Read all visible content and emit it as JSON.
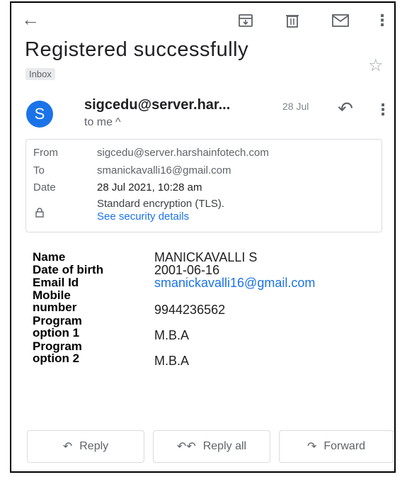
{
  "subject": "Registered successfully",
  "label_badge": "Inbox",
  "sender": {
    "avatar_letter": "S",
    "name": "sigcedu@server.har...",
    "date_short": "28 Jul",
    "to_line": "to me"
  },
  "details": {
    "from_label": "From",
    "from_value": "sigcedu@server.harshainfotech.com",
    "to_label": "To",
    "to_value": "smanickavalli16@gmail.com",
    "date_label": "Date",
    "date_value": "28 Jul 2021, 10:28 am",
    "encryption_text": "Standard encryption (TLS).",
    "security_link": "See security details"
  },
  "body_fields": [
    {
      "label": "Name",
      "value": "MANICKAVALLI S"
    },
    {
      "label": "Date of birth",
      "value": "2001-06-16"
    },
    {
      "label": "Email Id",
      "value": "smanickavalli16@gmail.com"
    },
    {
      "label": "Mobile number",
      "value": "9944236562"
    },
    {
      "label": "Program option 1",
      "value": "M.B.A"
    },
    {
      "label": "Program option 2",
      "value": "M.B.A"
    }
  ],
  "actions": {
    "reply": "Reply",
    "reply_all": "Reply all",
    "forward": "Forward"
  },
  "icons": {
    "back": "arrow-back-icon",
    "archive": "archive-icon",
    "delete": "trash-icon",
    "mark_unread": "mail-icon",
    "more": "more-vert-icon",
    "star": "star-outline-icon",
    "reply": "reply-icon",
    "lock": "lock-icon"
  },
  "colors": {
    "accent": "#1a73e8",
    "avatar_bg": "#1a73e8",
    "link": "#1a73e8"
  }
}
